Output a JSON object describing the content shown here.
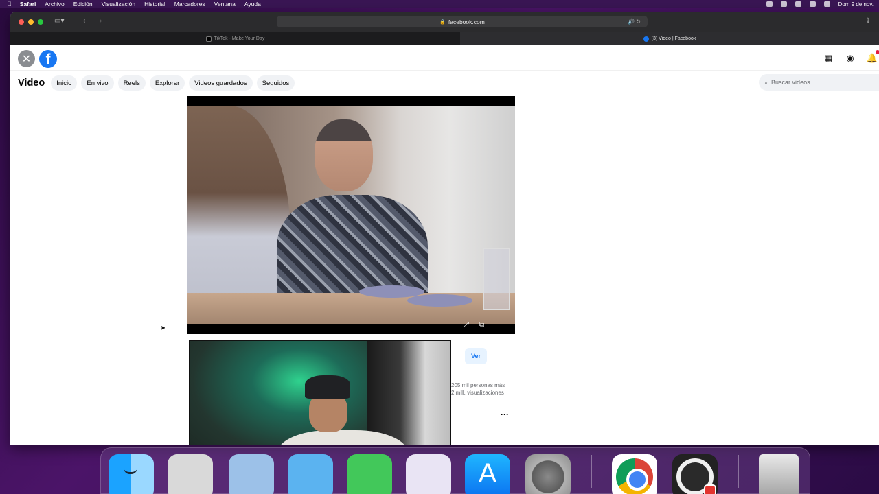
{
  "menubar": {
    "app": "Safari",
    "items": [
      "Archivo",
      "Edición",
      "Visualización",
      "Historial",
      "Marcadores",
      "Ventana",
      "Ayuda"
    ],
    "clock": "Dom 9 de nov."
  },
  "browser": {
    "url": "facebook.com",
    "tabs": [
      {
        "label": "TikTok - Make Your Day",
        "active": false
      },
      {
        "label": "(3) Video | Facebook",
        "active": true
      }
    ]
  },
  "facebook": {
    "section_title": "Video",
    "nav": [
      "Inicio",
      "En vivo",
      "Reels",
      "Explorar",
      "Videos guardados",
      "Seguidos"
    ],
    "search_placeholder": "Buscar videos",
    "ver_label": "Ver",
    "stats_line1": "205 mil personas más",
    "stats_line2": "2 mill. visualizaciones",
    "more_label": "···",
    "brand_color": "#1877f2"
  },
  "dock": {
    "apps": [
      "finder-icon",
      "launchpad-icon",
      "app-store-icon",
      "system-preferences-icon",
      "chrome-icon",
      "obs-icon",
      "trash-icon"
    ]
  }
}
